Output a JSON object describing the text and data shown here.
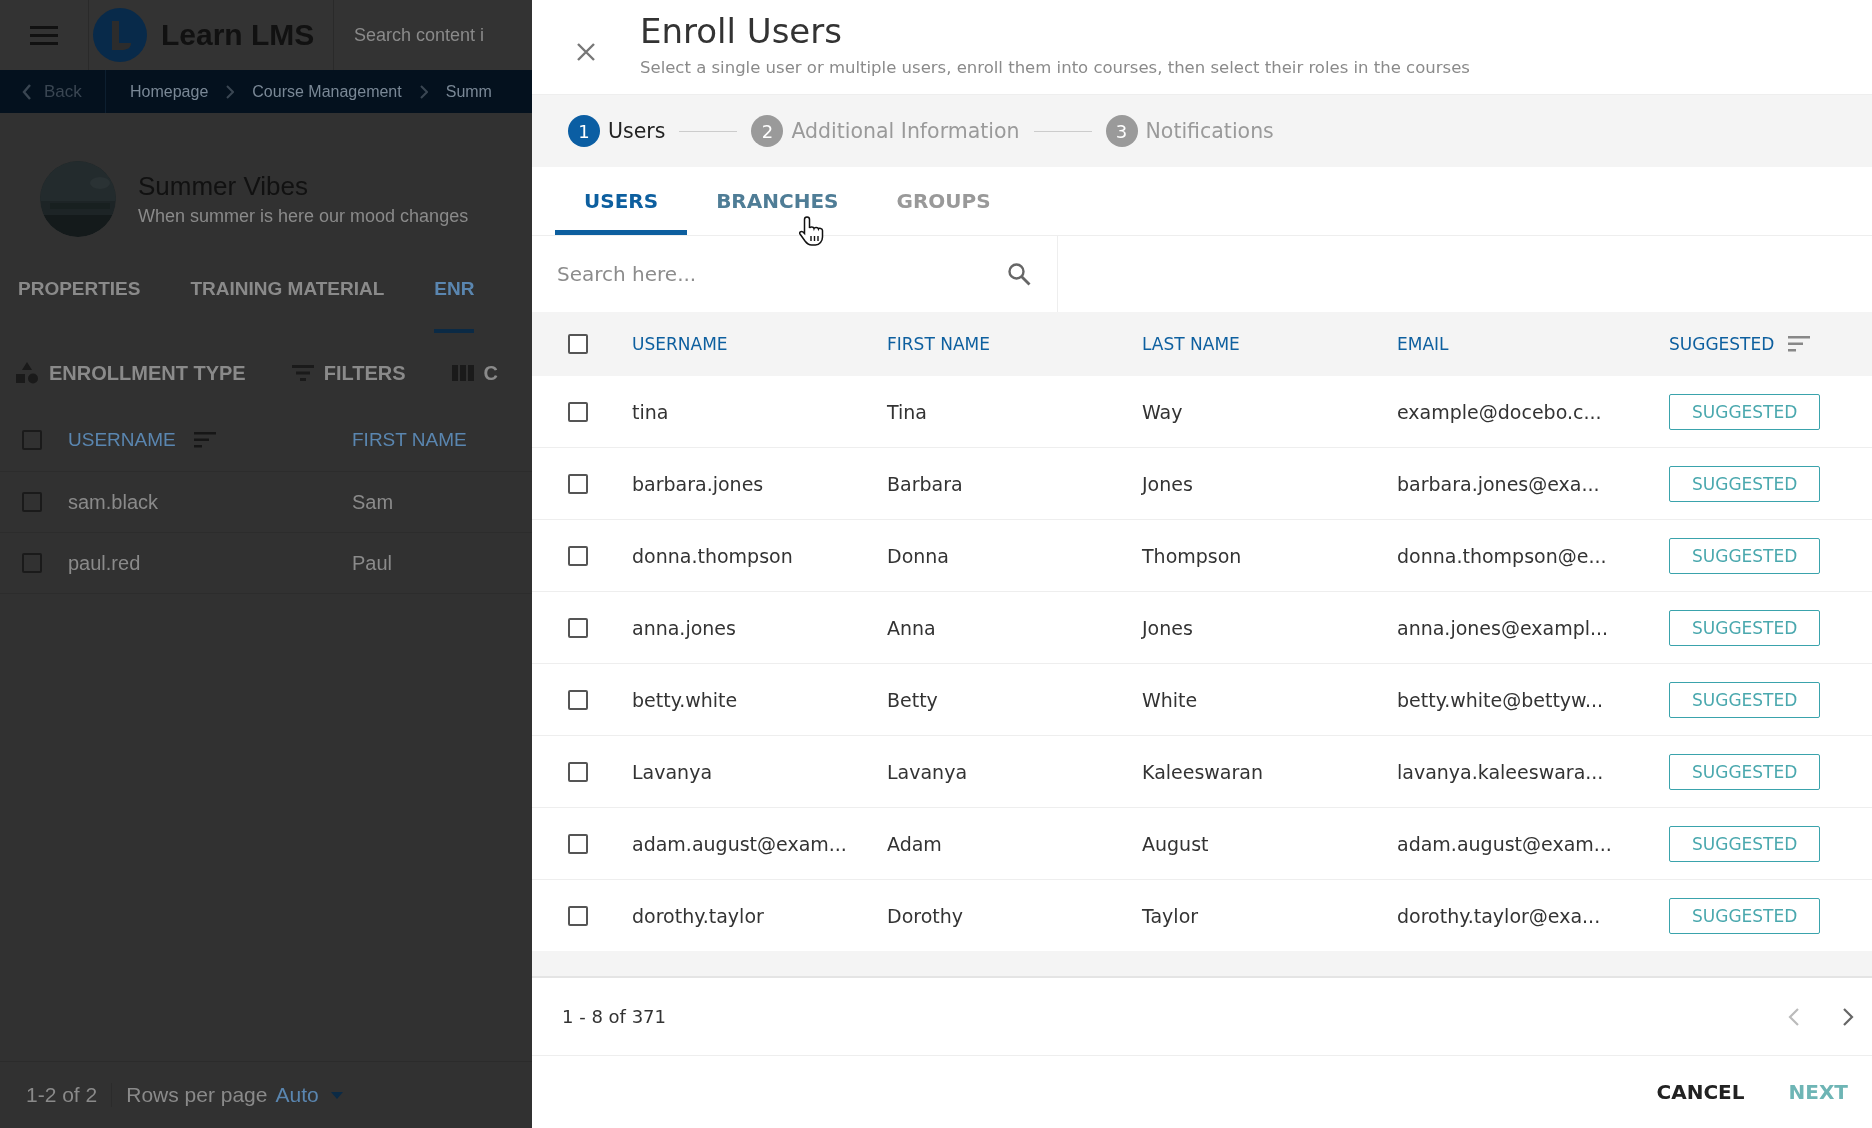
{
  "background": {
    "app_bar": {
      "title": "Learn LMS",
      "search": {
        "placeholder": "Search content i"
      }
    },
    "breadcrumb": {
      "back": "Back",
      "items": [
        "Homepage",
        "Course Management",
        "Summ"
      ]
    },
    "course": {
      "title": "Summer Vibes",
      "description": "When summer is here our mood changes"
    },
    "tabs": [
      {
        "label": "PROPERTIES",
        "selected": false
      },
      {
        "label": "TRAINING MATERIAL",
        "selected": false
      },
      {
        "label": "ENR",
        "selected": true
      }
    ],
    "toolbar": [
      {
        "kind": "enrollment",
        "label": "ENROLLMENT TYPE"
      },
      {
        "kind": "filters",
        "label": "FILTERS"
      },
      {
        "kind": "columns",
        "label": "C"
      }
    ],
    "table": {
      "select_all_checked": false,
      "columns": [
        "USERNAME",
        "FIRST NAME"
      ],
      "rows": [
        {
          "checked": false,
          "cells": [
            "sam.black",
            "Sam"
          ]
        },
        {
          "checked": false,
          "cells": [
            "paul.red",
            "Paul"
          ]
        }
      ]
    },
    "footer": {
      "range": "1-2 of 2",
      "rows_label": "Rows per page",
      "rows_value": "Auto"
    }
  },
  "dialog": {
    "title": "Enroll Users",
    "subtitle": "Select a single user or multiple users, enroll them into courses, then select their roles in the courses",
    "steps": [
      {
        "number": "1",
        "label": "Users",
        "selected": true
      },
      {
        "number": "2",
        "label": "Additional Information",
        "selected": false
      },
      {
        "number": "3",
        "label": "Notifications",
        "selected": false
      }
    ],
    "tabs": [
      {
        "label": "USERS",
        "selected": true,
        "hovered": false
      },
      {
        "label": "BRANCHES",
        "selected": false,
        "hovered": true
      },
      {
        "label": "GROUPS",
        "selected": false,
        "hovered": false
      }
    ],
    "search": {
      "placeholder": "Search here..."
    },
    "table": {
      "select_all_checked": false,
      "columns": [
        "USERNAME",
        "FIRST NAME",
        "LAST NAME",
        "EMAIL",
        "SUGGESTED"
      ],
      "rows": [
        {
          "checked": false,
          "cells": [
            "tina",
            "Tina",
            "Way",
            "example@docebo.c..."
          ],
          "tag": "SUGGESTED"
        },
        {
          "checked": false,
          "cells": [
            "barbara.jones",
            "Barbara",
            "Jones",
            "barbara.jones@exa..."
          ],
          "tag": "SUGGESTED"
        },
        {
          "checked": false,
          "cells": [
            "donna.thompson",
            "Donna",
            "Thompson",
            "donna.thompson@e..."
          ],
          "tag": "SUGGESTED"
        },
        {
          "checked": false,
          "cells": [
            "anna.jones",
            "Anna",
            "Jones",
            "anna.jones@exampl..."
          ],
          "tag": "SUGGESTED"
        },
        {
          "checked": false,
          "cells": [
            "betty.white",
            "Betty",
            "White",
            "betty.white@bettyw..."
          ],
          "tag": "SUGGESTED"
        },
        {
          "checked": false,
          "cells": [
            "Lavanya",
            "Lavanya",
            "Kaleeswaran",
            "lavanya.kaleeswara..."
          ],
          "tag": "SUGGESTED"
        },
        {
          "checked": false,
          "cells": [
            "adam.august@exam...",
            "Adam",
            "August",
            "adam.august@exam..."
          ],
          "tag": "SUGGESTED"
        },
        {
          "checked": false,
          "cells": [
            "dorothy.taylor",
            "Dorothy",
            "Taylor",
            "dorothy.taylor@exa..."
          ],
          "tag": "SUGGESTED"
        }
      ]
    },
    "pagination": {
      "range": "1 - 8 of 371",
      "prev_disabled": true,
      "next_disabled": false
    },
    "actions": [
      {
        "kind": "secondary",
        "label": "CANCEL"
      },
      {
        "kind": "primary",
        "label": "NEXT"
      }
    ]
  }
}
